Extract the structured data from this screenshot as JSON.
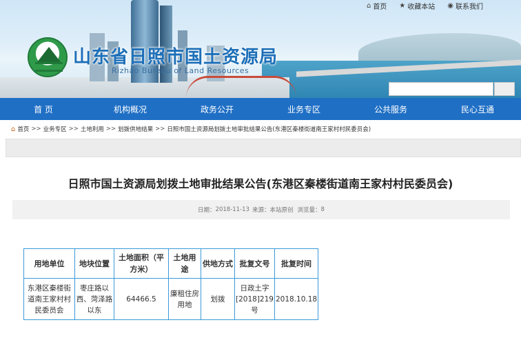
{
  "top_links": {
    "home": "首页",
    "favorite": "收藏本站",
    "contact": "联系我们"
  },
  "header": {
    "title": "山东省日照市国土资源局",
    "subtitle": "Rizhao Bureau of Land Resources"
  },
  "search": {
    "placeholder": ""
  },
  "nav": [
    "首 页",
    "机构概况",
    "政务公开",
    "业务专区",
    "公共服务",
    "民心互通"
  ],
  "breadcrumb": [
    "首页",
    "业务专区",
    "土地利用",
    "划拨供地结果",
    "日照市国土资源局划拨土地审批结果公告(东港区秦楼街道南王家村村民委员会)"
  ],
  "breadcrumb_sep": ">>",
  "article": {
    "title": "日照市国土资源局划拨土地审批结果公告(东港区秦楼街道南王家村村民委员会)",
    "meta": {
      "date_label": "日期：",
      "date": "2018-11-13",
      "source_label": "来源：",
      "source": "本站原创",
      "views_label": "浏览量：",
      "views": "8"
    }
  },
  "table": {
    "headers": [
      "用地单位",
      "地块位置",
      "土地面积（平方米）",
      "土地用途",
      "供地方式",
      "批复文号",
      "批复时间"
    ],
    "rows": [
      [
        "东港区秦楼街道南王家村村民委员会",
        "枣庄路以西、菏泽路以东",
        "64466.5",
        "廉租住房用地",
        "划拨",
        "日政土字[2018]219号",
        "2018.10.18"
      ]
    ]
  },
  "colors": {
    "nav_bg": "#1f6fc5",
    "title_blue": "#1d6fb8",
    "table_border": "#3a9ad9",
    "home_icon": "#c9621a"
  },
  "icons": [
    "home-icon",
    "star-icon",
    "location-pin-icon",
    "search-icon",
    "logo-mountain-icon"
  ]
}
